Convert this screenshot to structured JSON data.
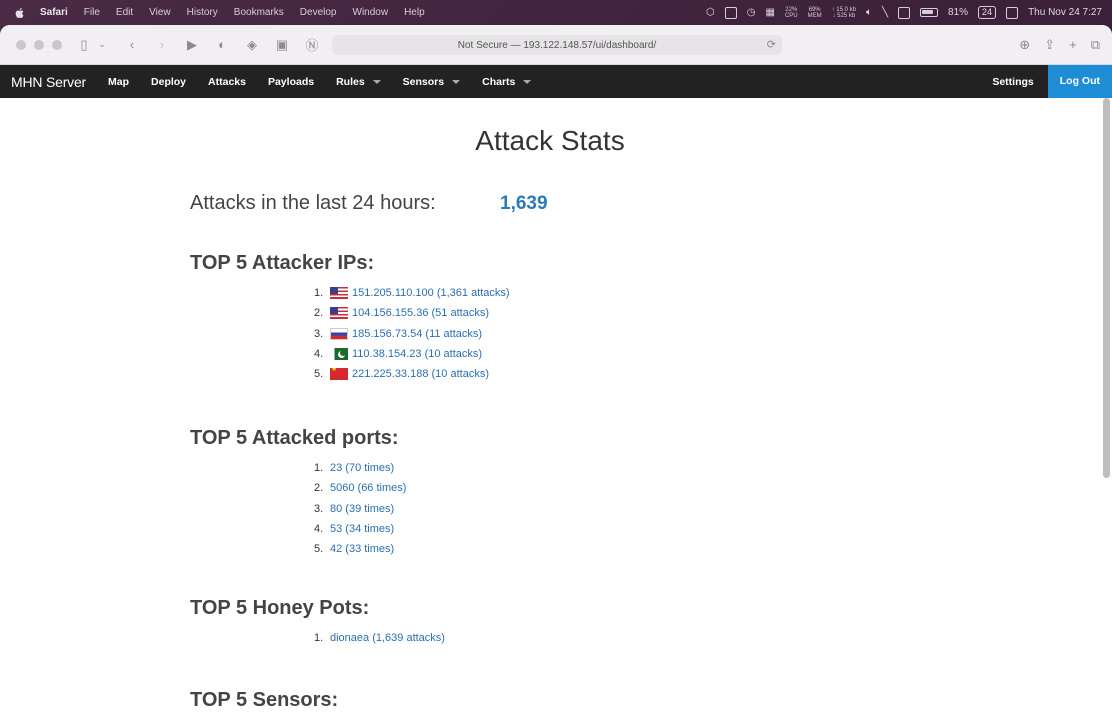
{
  "menubar": {
    "items": [
      "Safari",
      "File",
      "Edit",
      "View",
      "History",
      "Bookmarks",
      "Develop",
      "Window",
      "Help"
    ],
    "cpu": [
      "22%",
      "CPU"
    ],
    "mem": [
      "69%",
      "MEM"
    ],
    "net": [
      "↑ 15.0 kb",
      "↓ 525 kb"
    ],
    "battery": "81%",
    "calendar_day": "24",
    "clock": "Thu Nov 24  7:27"
  },
  "browser": {
    "url": "Not Secure — 193.122.148.57/ui/dashboard/"
  },
  "nav": {
    "brand": "MHN Server",
    "items": [
      {
        "label": "Map",
        "dropdown": false
      },
      {
        "label": "Deploy",
        "dropdown": false
      },
      {
        "label": "Attacks",
        "dropdown": false
      },
      {
        "label": "Payloads",
        "dropdown": false
      },
      {
        "label": "Rules",
        "dropdown": true
      },
      {
        "label": "Sensors",
        "dropdown": true
      },
      {
        "label": "Charts",
        "dropdown": true
      }
    ],
    "settings": "Settings",
    "logout": "Log Out"
  },
  "page": {
    "title": "Attack Stats",
    "summary_label": "Attacks in the last 24 hours:",
    "summary_value": "1,639"
  },
  "sections": {
    "ips": {
      "title": "TOP 5 Attacker IPs:",
      "items": [
        {
          "num": "1.",
          "flag": "us",
          "text": "151.205.110.100 (1,361 attacks)"
        },
        {
          "num": "2.",
          "flag": "us",
          "text": "104.156.155.36 (51 attacks)"
        },
        {
          "num": "3.",
          "flag": "ru",
          "text": "185.156.73.54 (11 attacks)"
        },
        {
          "num": "4.",
          "flag": "pk",
          "text": "110.38.154.23 (10 attacks)"
        },
        {
          "num": "5.",
          "flag": "cn",
          "text": "221.225.33.188 (10 attacks)"
        }
      ]
    },
    "ports": {
      "title": "TOP 5 Attacked ports:",
      "items": [
        {
          "num": "1.",
          "text": "23 (70 times)"
        },
        {
          "num": "2.",
          "text": "5060 (66 times)"
        },
        {
          "num": "3.",
          "text": "80 (39 times)"
        },
        {
          "num": "4.",
          "text": "53 (34 times)"
        },
        {
          "num": "5.",
          "text": "42 (33 times)"
        }
      ]
    },
    "honeypots": {
      "title": "TOP 5 Honey Pots:",
      "items": [
        {
          "num": "1.",
          "text": "dionaea (1,639 attacks)"
        }
      ]
    },
    "sensors": {
      "title": "TOP 5 Sensors:"
    }
  }
}
